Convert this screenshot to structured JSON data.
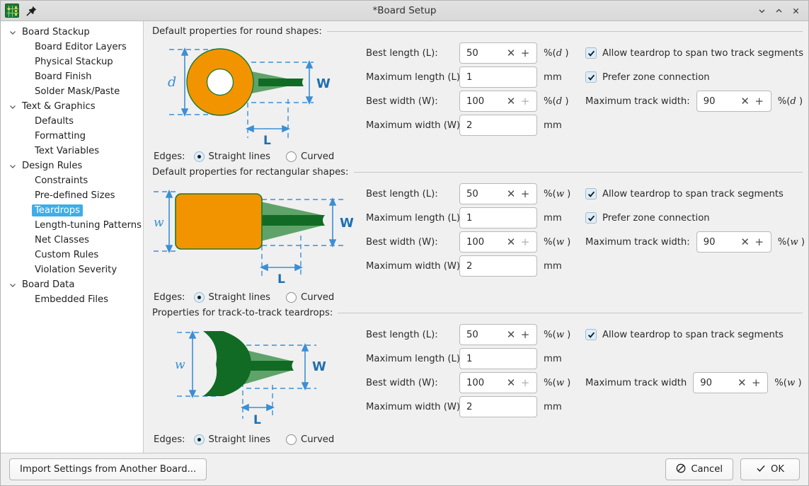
{
  "window": {
    "title": "*Board Setup",
    "app_icon": "kicad-pcb-icon",
    "pin_icon": "pin-icon",
    "minimize_icon": "chevron-down-icon",
    "maximize_icon": "chevron-up-icon",
    "close_icon": "close-icon",
    "accent": "#3daee9"
  },
  "sidebar": {
    "items": [
      {
        "label": "Board Stackup",
        "level": "group",
        "expanded": true,
        "twisty": "chevron-down-icon",
        "selected": false
      },
      {
        "label": "Board Editor Layers",
        "level": "child",
        "selected": false
      },
      {
        "label": "Physical Stackup",
        "level": "child",
        "selected": false
      },
      {
        "label": "Board Finish",
        "level": "child",
        "selected": false
      },
      {
        "label": "Solder Mask/Paste",
        "level": "child",
        "selected": false
      },
      {
        "label": "Text & Graphics",
        "level": "group",
        "expanded": true,
        "twisty": "chevron-down-icon",
        "selected": false
      },
      {
        "label": "Defaults",
        "level": "child",
        "selected": false
      },
      {
        "label": "Formatting",
        "level": "child",
        "selected": false
      },
      {
        "label": "Text Variables",
        "level": "child",
        "selected": false
      },
      {
        "label": "Design Rules",
        "level": "group",
        "expanded": true,
        "twisty": "chevron-down-icon",
        "selected": false
      },
      {
        "label": "Constraints",
        "level": "child",
        "selected": false
      },
      {
        "label": "Pre-defined Sizes",
        "level": "child",
        "selected": false
      },
      {
        "label": "Teardrops",
        "level": "child",
        "selected": true
      },
      {
        "label": "Length-tuning Patterns",
        "level": "child",
        "selected": false
      },
      {
        "label": "Net Classes",
        "level": "child",
        "selected": false
      },
      {
        "label": "Custom Rules",
        "level": "child",
        "selected": false
      },
      {
        "label": "Violation Severity",
        "level": "child",
        "selected": false
      },
      {
        "label": "Board Data",
        "level": "group",
        "expanded": true,
        "twisty": "chevron-down-icon",
        "selected": false
      },
      {
        "label": "Embedded Files",
        "level": "child",
        "selected": false
      }
    ]
  },
  "sections": {
    "round": {
      "header": "Default properties for round shapes:",
      "diagram": {
        "name": "round-pad-teardrop-diagram",
        "dim_d_label": "d",
        "dim_W_label": "W",
        "dim_L_label": "L",
        "pad_color": "#f29400",
        "pad_outline": "#1b7a2f",
        "track_color": "#1b7a2f",
        "teardrop_color": "#5fa36b",
        "dim_color": "#3b8fd4"
      },
      "edges": {
        "label": "Edges:",
        "options": [
          {
            "label": "Straight lines",
            "selected": true
          },
          {
            "label": "Curved",
            "selected": false
          }
        ]
      },
      "best_length": {
        "label": "Best length (L):",
        "value": "50",
        "unit": "%(d )",
        "unit_sym": "d",
        "plus_enabled": true
      },
      "maximum_length": {
        "label": "Maximum length (L):",
        "value": "1",
        "unit": "mm"
      },
      "best_width": {
        "label": "Best width (W):",
        "value": "100",
        "unit": "%(d )",
        "unit_sym": "d",
        "plus_enabled": false
      },
      "maximum_width": {
        "label": "Maximum width (W):",
        "value": "2",
        "unit": "mm"
      },
      "checkbox_span": {
        "label": "Allow teardrop to span two track segments",
        "checked": true
      },
      "checkbox_zone": {
        "label": "Prefer zone connection",
        "checked": true
      },
      "max_track_width": {
        "label": "Maximum track width:",
        "value": "90",
        "unit": "%(d )",
        "unit_sym": "d",
        "plus_enabled": true
      }
    },
    "rect": {
      "header": "Default properties for rectangular shapes:",
      "diagram": {
        "name": "rect-pad-teardrop-diagram",
        "dim_w_label": "w",
        "dim_W_label": "W",
        "dim_L_label": "L"
      },
      "edges": {
        "label": "Edges:",
        "options": [
          {
            "label": "Straight lines",
            "selected": true
          },
          {
            "label": "Curved",
            "selected": false
          }
        ]
      },
      "best_length": {
        "label": "Best length (L):",
        "value": "50",
        "unit": "%(w )",
        "unit_sym": "w",
        "plus_enabled": true
      },
      "maximum_length": {
        "label": "Maximum length (L):",
        "value": "1",
        "unit": "mm"
      },
      "best_width": {
        "label": "Best width (W):",
        "value": "100",
        "unit": "%(w )",
        "unit_sym": "w",
        "plus_enabled": false
      },
      "maximum_width": {
        "label": "Maximum width (W):",
        "value": "2",
        "unit": "mm"
      },
      "checkbox_span": {
        "label": "Allow teardrop to span track segments",
        "checked": true
      },
      "checkbox_zone": {
        "label": "Prefer zone connection",
        "checked": true
      },
      "max_track_width": {
        "label": "Maximum track width:",
        "value": "90",
        "unit": "%(w )",
        "unit_sym": "w",
        "plus_enabled": true
      }
    },
    "track": {
      "header": "Properties for track-to-track teardrops:",
      "diagram": {
        "name": "track-to-track-teardrop-diagram",
        "dim_w_label": "w",
        "dim_W_label": "W",
        "dim_L_label": "L"
      },
      "edges": {
        "label": "Edges:",
        "options": [
          {
            "label": "Straight lines",
            "selected": true
          },
          {
            "label": "Curved",
            "selected": false
          }
        ]
      },
      "best_length": {
        "label": "Best length (L):",
        "value": "50",
        "unit": "%(w )",
        "unit_sym": "w",
        "plus_enabled": true
      },
      "maximum_length": {
        "label": "Maximum length (L):",
        "value": "1",
        "unit": "mm"
      },
      "best_width": {
        "label": "Best width (W):",
        "value": "100",
        "unit": "%(w )",
        "unit_sym": "w",
        "plus_enabled": false
      },
      "maximum_width": {
        "label": "Maximum width (W):",
        "value": "2",
        "unit": "mm"
      },
      "checkbox_span": {
        "label": "Allow teardrop to span track segments",
        "checked": true
      },
      "max_track_width": {
        "label": "Maximum track width",
        "value": "90",
        "unit": "%(w )",
        "unit_sym": "w",
        "plus_enabled": true
      }
    }
  },
  "footer": {
    "import_label": "Import Settings from Another Board...",
    "cancel_label": "Cancel",
    "cancel_icon": "no-entry-icon",
    "ok_label": "OK",
    "ok_icon": "check-icon"
  },
  "spinner": {
    "decrement_icon": "cross-icon",
    "increment_icon": "plus-icon",
    "decrement_glyph": "✕",
    "increment_glyph": "+"
  }
}
